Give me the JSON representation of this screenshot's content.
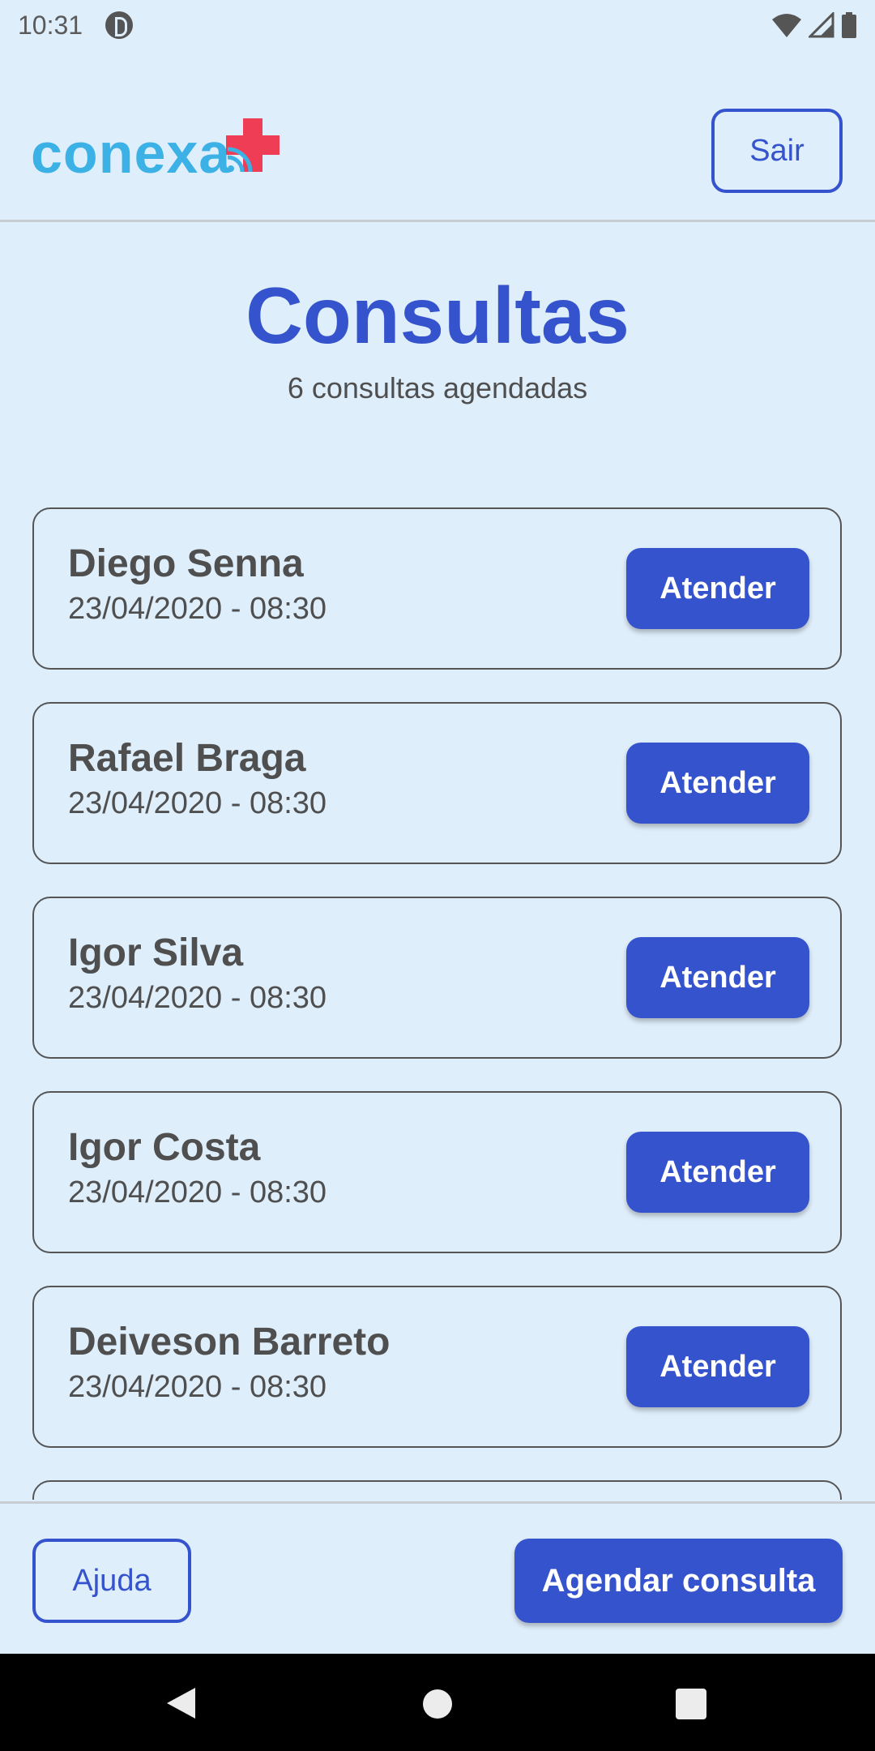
{
  "status_bar": {
    "time": "10:31"
  },
  "header": {
    "logo_text": "conexa",
    "logout_label": "Sair"
  },
  "main": {
    "title": "Consultas",
    "subtitle": "6 consultas agendadas",
    "appointments": [
      {
        "name": "Diego Senna",
        "datetime": "23/04/2020 - 08:30",
        "action": "Atender"
      },
      {
        "name": "Rafael Braga",
        "datetime": "23/04/2020 - 08:30",
        "action": "Atender"
      },
      {
        "name": "Igor Silva",
        "datetime": "23/04/2020 - 08:30",
        "action": "Atender"
      },
      {
        "name": "Igor Costa",
        "datetime": "23/04/2020 - 08:30",
        "action": "Atender"
      },
      {
        "name": "Deiveson Barreto",
        "datetime": "23/04/2020 - 08:30",
        "action": "Atender"
      },
      {
        "name": "",
        "datetime": "",
        "action": ""
      }
    ]
  },
  "footer": {
    "help_label": "Ajuda",
    "schedule_label": "Agendar consulta"
  },
  "colors": {
    "background": "#dfeefb",
    "primary": "#3553cc",
    "logo_blue": "#3bb1e5",
    "logo_red": "#ee3d55",
    "text": "#4f4f4f"
  }
}
